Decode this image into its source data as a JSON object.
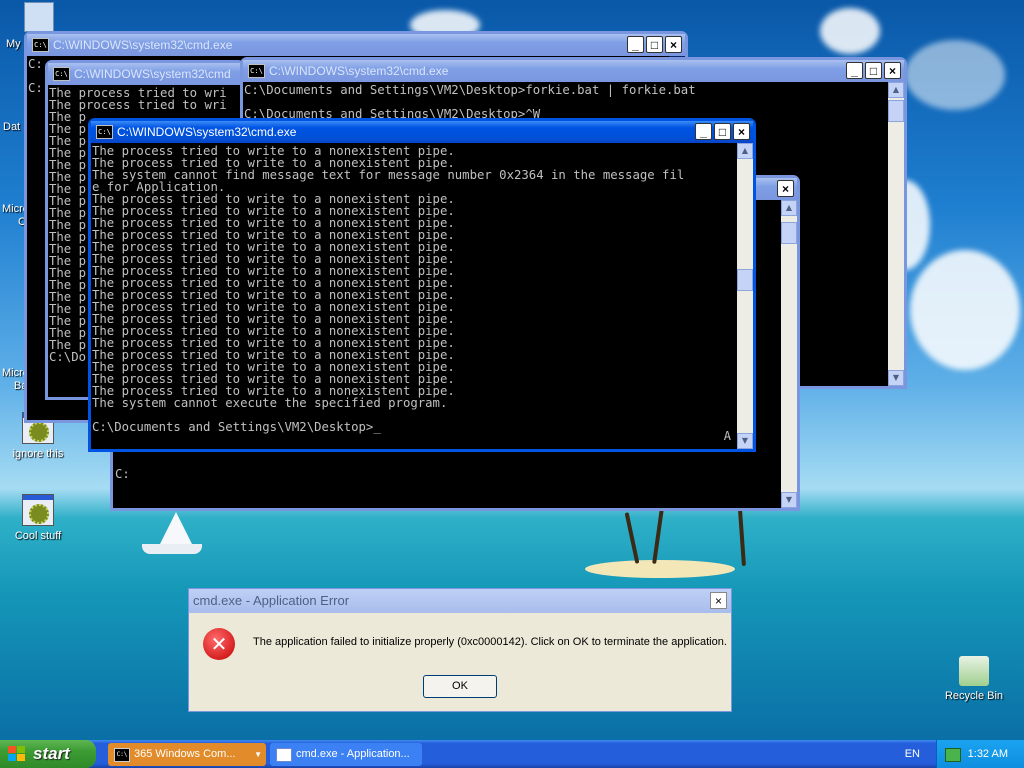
{
  "desktop": {
    "icons": [
      {
        "id": "ignore-this",
        "label": "ignore this"
      },
      {
        "id": "cool-stuff",
        "label": "Cool stuff"
      },
      {
        "id": "recycle-bin",
        "label": "Recycle Bin"
      }
    ],
    "edge_labels": [
      "My",
      "Dat",
      "Micro",
      "C",
      "Microsoft",
      "Basic"
    ]
  },
  "windows": {
    "w1": {
      "title": "C:\\WINDOWS\\system32\\cmd.exe",
      "lines": [
        "C:",
        "",
        "C:"
      ]
    },
    "w2": {
      "title": "C:\\WINDOWS\\system32\\cmd",
      "lines": [
        "The process tried to wri",
        "The process tried to wri",
        "The p",
        "The p",
        "The p",
        "The p",
        "The p",
        "The p",
        "The p",
        "The p",
        "The p",
        "The p",
        "The p",
        "The p",
        "The p",
        "The p",
        "The p",
        "The p",
        "The p",
        "The p",
        "The p",
        "The p",
        "C:\\Do"
      ]
    },
    "w3": {
      "title": "C:\\WINDOWS\\system32\\cmd.exe",
      "lines": [
        "C:\\Documents and Settings\\VM2\\Desktop>forkie.bat | forkie.bat",
        "",
        "C:\\Documents and Settings\\VM2\\Desktop>^W"
      ],
      "bottom_prompt": "C:"
    },
    "w4": {
      "title": ""
    },
    "w5": {
      "title": "C:\\WINDOWS\\system32\\cmd.exe",
      "lines": [
        "The process tried to write to a nonexistent pipe.",
        "The process tried to write to a nonexistent pipe.",
        "The system cannot find message text for message number 0x2364 in the message fil",
        "e for Application.",
        "The process tried to write to a nonexistent pipe.",
        "The process tried to write to a nonexistent pipe.",
        "The process tried to write to a nonexistent pipe.",
        "The process tried to write to a nonexistent pipe.",
        "The process tried to write to a nonexistent pipe.",
        "The process tried to write to a nonexistent pipe.",
        "The process tried to write to a nonexistent pipe.",
        "The process tried to write to a nonexistent pipe.",
        "The process tried to write to a nonexistent pipe.",
        "The process tried to write to a nonexistent pipe.",
        "The process tried to write to a nonexistent pipe.",
        "The process tried to write to a nonexistent pipe.",
        "The process tried to write to a nonexistent pipe.",
        "The process tried to write to a nonexistent pipe.",
        "The process tried to write to a nonexistent pipe.",
        "The process tried to write to a nonexistent pipe.",
        "The process tried to write to a nonexistent pipe.",
        "The system cannot execute the specified program.",
        "",
        "C:\\Documents and Settings\\VM2\\Desktop>_"
      ],
      "corner_char": "A"
    }
  },
  "dialog": {
    "title": "cmd.exe - Application Error",
    "message": "The application failed to initialize properly (0xc0000142). Click on OK to terminate the application.",
    "ok_label": "OK",
    "close_glyph": "×"
  },
  "taskbar": {
    "start_label": "start",
    "tasks": [
      {
        "label": "365 Windows Com...",
        "active": true
      },
      {
        "label": "cmd.exe - Application...",
        "active": false
      }
    ],
    "language": "EN",
    "time": "1:32 AM"
  },
  "window_buttons": {
    "min": "_",
    "max": "□",
    "close": "×"
  },
  "colors": {
    "accent": "#0054e3",
    "taskbar": "#245edb",
    "start": "#3c9c33",
    "error": "#c40000",
    "dialog_bg": "#ece9d8"
  }
}
